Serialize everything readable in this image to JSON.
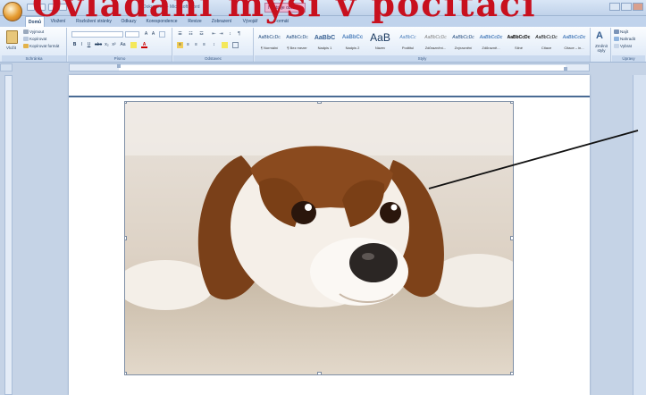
{
  "headline": "Ovládání myši v počítači",
  "window": {
    "title": "Dokument1 - Microsoft Word",
    "context_tool": "Nástroje obrázku"
  },
  "tabs": [
    {
      "label": "Domů",
      "active": true
    },
    {
      "label": "Vložení",
      "active": false
    },
    {
      "label": "Rozložení stránky",
      "active": false
    },
    {
      "label": "Odkazy",
      "active": false
    },
    {
      "label": "Korespondence",
      "active": false
    },
    {
      "label": "Revize",
      "active": false
    },
    {
      "label": "Zobrazení",
      "active": false
    },
    {
      "label": "Vývojář",
      "active": false
    },
    {
      "label": "Formát",
      "active": false
    }
  ],
  "clipboard": {
    "paste": "Vložit",
    "cut": "Vyjmout",
    "copy": "Kopírovat",
    "format_painter": "Kopírovat formát",
    "group": "Schránka"
  },
  "font": {
    "name": "",
    "size": "",
    "group": "Písmo"
  },
  "paragraph": {
    "group": "Odstavec"
  },
  "styles": {
    "group": "Styly",
    "items": [
      {
        "sample": "AaBbCcDc",
        "name": "¶ Normální"
      },
      {
        "sample": "AaBbCcDc",
        "name": "¶ Bez mezer"
      },
      {
        "sample": "AaBbC",
        "name": "Nadpis 1"
      },
      {
        "sample": "AaBbCc",
        "name": "Nadpis 2"
      },
      {
        "sample": "AaB",
        "name": "Název"
      },
      {
        "sample": "AaBbCc",
        "name": "Podtitul"
      },
      {
        "sample": "AaBbCcDc",
        "name": "Zdůraznění..."
      },
      {
        "sample": "AaBbCcDc",
        "name": "Zvýraznění"
      },
      {
        "sample": "AaBbCcDc",
        "name": "Zdůrazně..."
      },
      {
        "sample": "AaBbCcDc",
        "name": "Silné"
      },
      {
        "sample": "AaBbCcDc",
        "name": "Citace"
      },
      {
        "sample": "AaBbCcDc",
        "name": "Citace – in..."
      }
    ],
    "change_styles": "Změnit styly"
  },
  "editing": {
    "find": "Najít",
    "replace": "Nahradit",
    "select": "Vybrat",
    "group": "Úpravy"
  },
  "colors": {
    "title_red": "#c8101e",
    "ribbon_blue": "#dbe7f6",
    "workspace": "#c5d3e6"
  }
}
